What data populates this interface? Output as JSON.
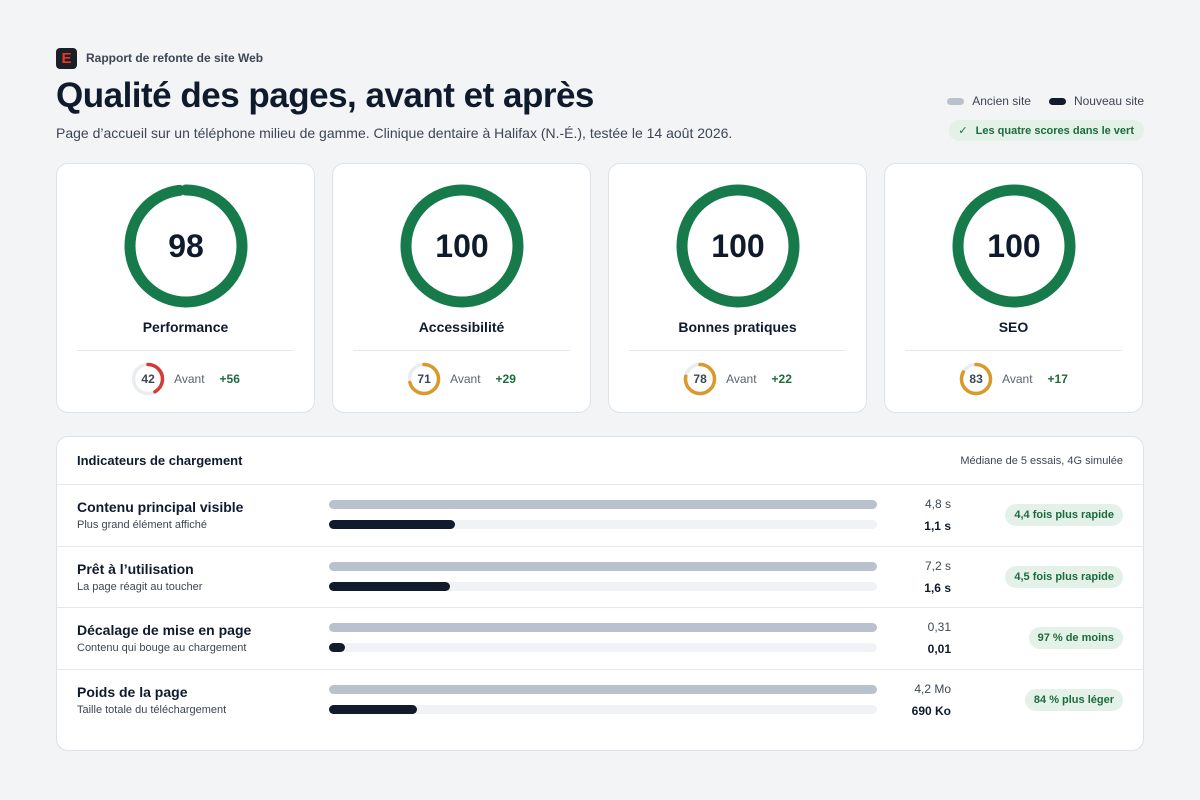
{
  "header": {
    "brand_letter": "E",
    "brand_name": "Rapport de refonte de site Web",
    "title": "Qualité des pages, avant et après",
    "subtitle": "Page d’accueil sur un téléphone milieu de gamme. Clinique dentaire à Halifax (N.-É.), testée le 14 août 2026."
  },
  "legend": {
    "old_label": "Ancien site",
    "new_label": "Nouveau site",
    "old_color": "#b9c2cc",
    "new_color": "#111b2b"
  },
  "pass_badge": {
    "icon": "check-icon",
    "label": "Les quatre scores dans le vert"
  },
  "colors": {
    "good": "#167a4a",
    "average": "#d99a2b",
    "poor": "#cf3d35",
    "track": "#e9ecf0"
  },
  "scores": [
    {
      "label": "Performance",
      "after": 98,
      "before": 42,
      "before_label": "Avant",
      "delta": "+56"
    },
    {
      "label": "Accessibilité",
      "after": 100,
      "before": 71,
      "before_label": "Avant",
      "delta": "+29"
    },
    {
      "label": "Bonnes pratiques",
      "after": 100,
      "before": 78,
      "before_label": "Avant",
      "delta": "+22"
    },
    {
      "label": "SEO",
      "after": 100,
      "before": 83,
      "before_label": "Avant",
      "delta": "+17"
    }
  ],
  "metrics": {
    "title": "Indicateurs de chargement",
    "note": "Médiane de 5 essais, 4G simulée",
    "rows": [
      {
        "name": "Contenu principal visible",
        "desc": "Plus grand élément affiché",
        "old": "4,8 s",
        "new": "1,1 s",
        "new_ratio": 0.23,
        "gain": "4,4 fois plus rapide"
      },
      {
        "name": "Prêt à l’utilisation",
        "desc": "La page réagit au toucher",
        "old": "7,2 s",
        "new": "1,6 s",
        "new_ratio": 0.22,
        "gain": "4,5 fois plus rapide"
      },
      {
        "name": "Décalage de mise en page",
        "desc": "Contenu qui bouge au chargement",
        "old": "0,31",
        "new": "0,01",
        "new_ratio": 0.03,
        "gain": "97 % de moins"
      },
      {
        "name": "Poids de la page",
        "desc": "Taille totale du téléchargement",
        "old": "4,2 Mo",
        "new": "690 Ko",
        "new_ratio": 0.16,
        "gain": "84 % plus léger"
      }
    ]
  }
}
